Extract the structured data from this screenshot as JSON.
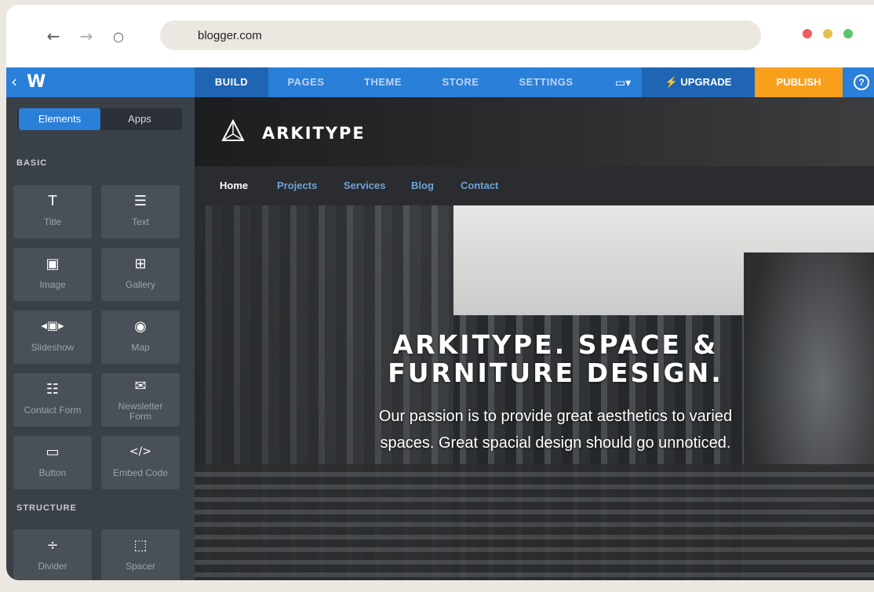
{
  "browser": {
    "url": "blogger.com",
    "back_glyph": "←",
    "forward_glyph": "→",
    "reload_glyph": "○",
    "dots": [
      "#ee5c5c",
      "#e4c04f",
      "#5cc46a"
    ]
  },
  "editor": {
    "tabs": [
      {
        "label": "BUILD",
        "active": true
      },
      {
        "label": "PAGES",
        "active": false
      },
      {
        "label": "THEME",
        "active": false
      },
      {
        "label": "STORE",
        "active": false
      },
      {
        "label": "SETTINGS",
        "active": false
      }
    ],
    "device_glyph": "▭▾",
    "upgrade_label": "⚡ UPGRADE",
    "publish_label": "PUBLISH",
    "help_glyph": "?"
  },
  "sidebar": {
    "segments": {
      "elements": "Elements",
      "apps": "Apps"
    },
    "basic_label": "BASIC",
    "structure_label": "STRUCTURE",
    "items": [
      {
        "label": "Title",
        "icon": "T"
      },
      {
        "label": "Text",
        "icon": "☰"
      },
      {
        "label": "Image",
        "icon": "▣"
      },
      {
        "label": "Gallery",
        "icon": "⊞"
      },
      {
        "label": "Slideshow",
        "icon": "◂▣▸"
      },
      {
        "label": "Map",
        "icon": "◉"
      },
      {
        "label": "Contact Form",
        "icon": "☷"
      },
      {
        "label": "Newsletter Form",
        "icon": "✉"
      },
      {
        "label": "Button",
        "icon": "▭"
      },
      {
        "label": "Embed Code",
        "icon": "</>"
      }
    ],
    "structure_items": [
      {
        "label": "Divider",
        "icon": "÷"
      },
      {
        "label": "Spacer",
        "icon": "⬚"
      }
    ]
  },
  "site": {
    "brand": "ARKITYPE",
    "nav": [
      "Home",
      "Projects",
      "Services",
      "Blog",
      "Contact"
    ],
    "hero_title": "ARKITYPE. SPACE & FURNITURE DESIGN.",
    "hero_subtitle": "Our passion is to provide great aesthetics to varied spaces. Great spacial design should go unnoticed."
  },
  "colors": {
    "accent": "#2a7fd8",
    "accent_dark": "#1f65b4",
    "publish": "#f8a01b",
    "sidebar": "#3a4047",
    "tile": "#4a5058"
  }
}
